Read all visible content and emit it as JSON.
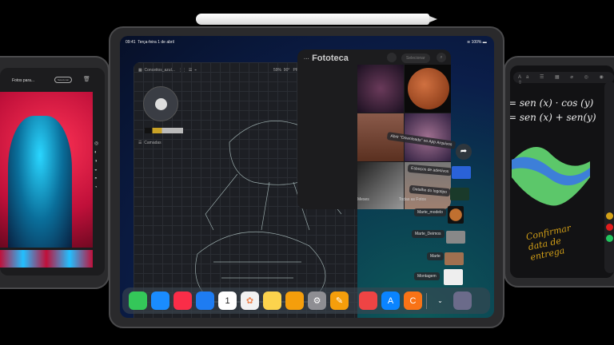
{
  "center_ipad": {
    "status": {
      "time": "09:41",
      "date": "Terça-feira 1 de abril",
      "battery": "100%"
    },
    "concepts": {
      "file_name": "Conceitos_azul...",
      "zoom": "59%",
      "angle": "90°",
      "pro": "PRO",
      "layers_label": "Camadas"
    },
    "photos": {
      "title": "Fototeca",
      "select_label": "Selecionar",
      "tabs": [
        "Meses",
        "Todas as Fotos"
      ]
    },
    "drag_items": [
      {
        "label": "Abrir \"Downloads\" no App Arquivos"
      },
      {
        "label": "Esboços de adesivos"
      },
      {
        "label": "Detalhe do logotipo"
      },
      {
        "label": "Marte_modelo"
      },
      {
        "label": "Marte_Deimos"
      },
      {
        "label": "Marte"
      },
      {
        "label": "Montagem"
      }
    ],
    "dock": [
      {
        "name": "messages",
        "icon": "💬",
        "color": "#34c759"
      },
      {
        "name": "safari",
        "icon": "◎",
        "color": "#1a8cff"
      },
      {
        "name": "music",
        "icon": "♫",
        "color": "#fa2d48"
      },
      {
        "name": "mail",
        "icon": "✉",
        "color": "#1e7cf2"
      },
      {
        "name": "calendar",
        "icon": "1",
        "color": "#ffffff"
      },
      {
        "name": "photos",
        "icon": "✿",
        "color": "#f2f2f2"
      },
      {
        "name": "notes",
        "icon": "≡",
        "color": "#fcd34d"
      },
      {
        "name": "files",
        "icon": "▬",
        "color": "#f59e0b"
      },
      {
        "name": "settings",
        "icon": "⚙",
        "color": "#8e8e93"
      },
      {
        "name": "concepts",
        "icon": "✎",
        "color": "#f59e0b"
      },
      {
        "name": "rocket",
        "icon": "🚀",
        "color": "#ef4444"
      },
      {
        "name": "app-store",
        "icon": "A",
        "color": "#0a84ff"
      },
      {
        "name": "swift-playgrounds",
        "icon": "C",
        "color": "#f97316"
      }
    ]
  },
  "left_ipad": {
    "title": "Fotos para...",
    "selecionar": "Selecionar"
  },
  "right_ipad": {
    "formula1": "= sen (x) · cos (y)",
    "formula2": "= sen (x) + sen(y)",
    "note": "Confirmar data de entrega",
    "swatches": [
      "#d4a017",
      "#e11d1d",
      "#22c55e"
    ]
  }
}
